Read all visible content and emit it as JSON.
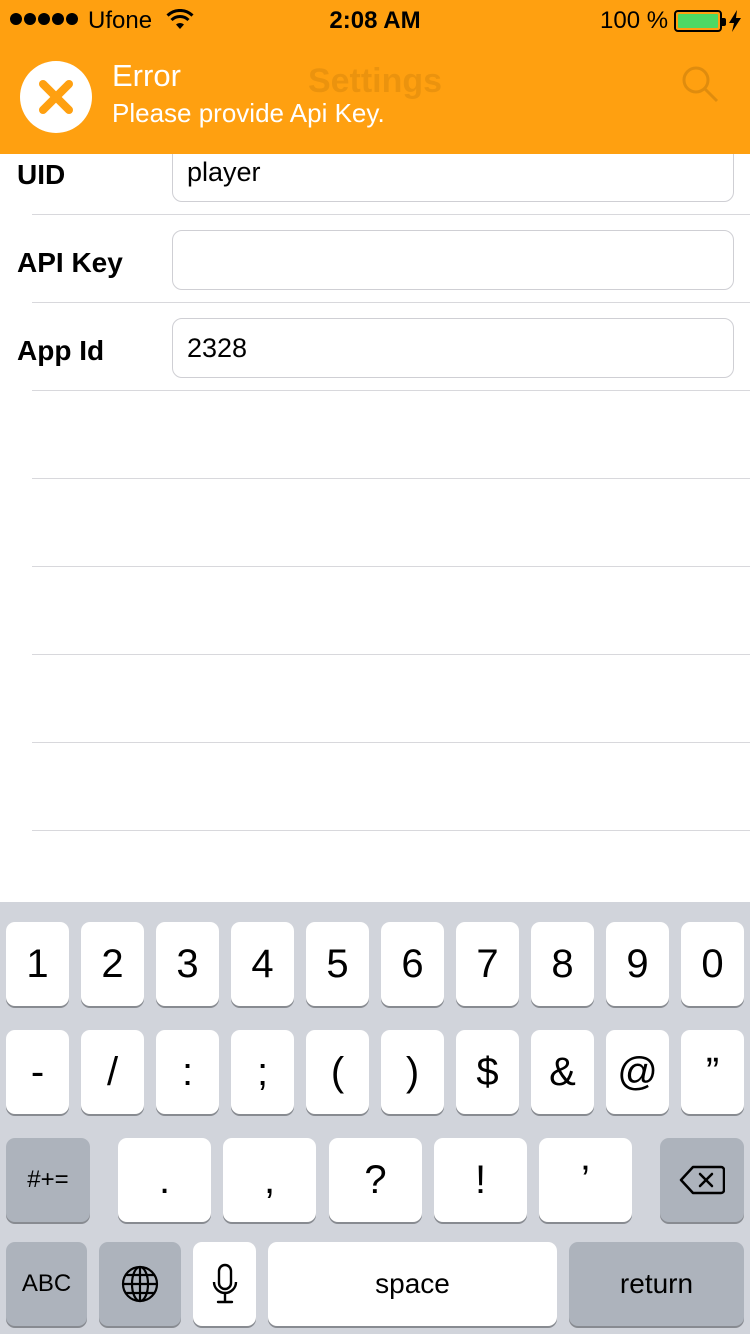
{
  "status_bar": {
    "carrier": "Ufone",
    "time": "2:08 AM",
    "battery": "100 %"
  },
  "banner": {
    "icon": "close-circle-icon",
    "title": "Error",
    "message": "Please provide Api Key.",
    "nav_title": "Settings",
    "background_color": "#FFA010"
  },
  "form": {
    "rows": [
      {
        "label": "UID",
        "value": "player",
        "placeholder": ""
      },
      {
        "label": "API Key",
        "value": "",
        "placeholder": ""
      },
      {
        "label": "App Id",
        "value": "2328",
        "placeholder": ""
      }
    ]
  },
  "keyboard": {
    "row1": [
      "1",
      "2",
      "3",
      "4",
      "5",
      "6",
      "7",
      "8",
      "9",
      "0"
    ],
    "row2": [
      "-",
      "/",
      ":",
      ";",
      "(",
      ")",
      "$",
      "&",
      "@",
      "”"
    ],
    "row3": {
      "symbols_toggle": "#+=",
      "keys": [
        ".",
        ",",
        "?",
        "!",
        "’"
      ],
      "delete_icon": "backspace-icon"
    },
    "row4": {
      "abc": "ABC",
      "globe_icon": "globe-icon",
      "mic_icon": "microphone-icon",
      "space": "space",
      "return": "return"
    }
  }
}
